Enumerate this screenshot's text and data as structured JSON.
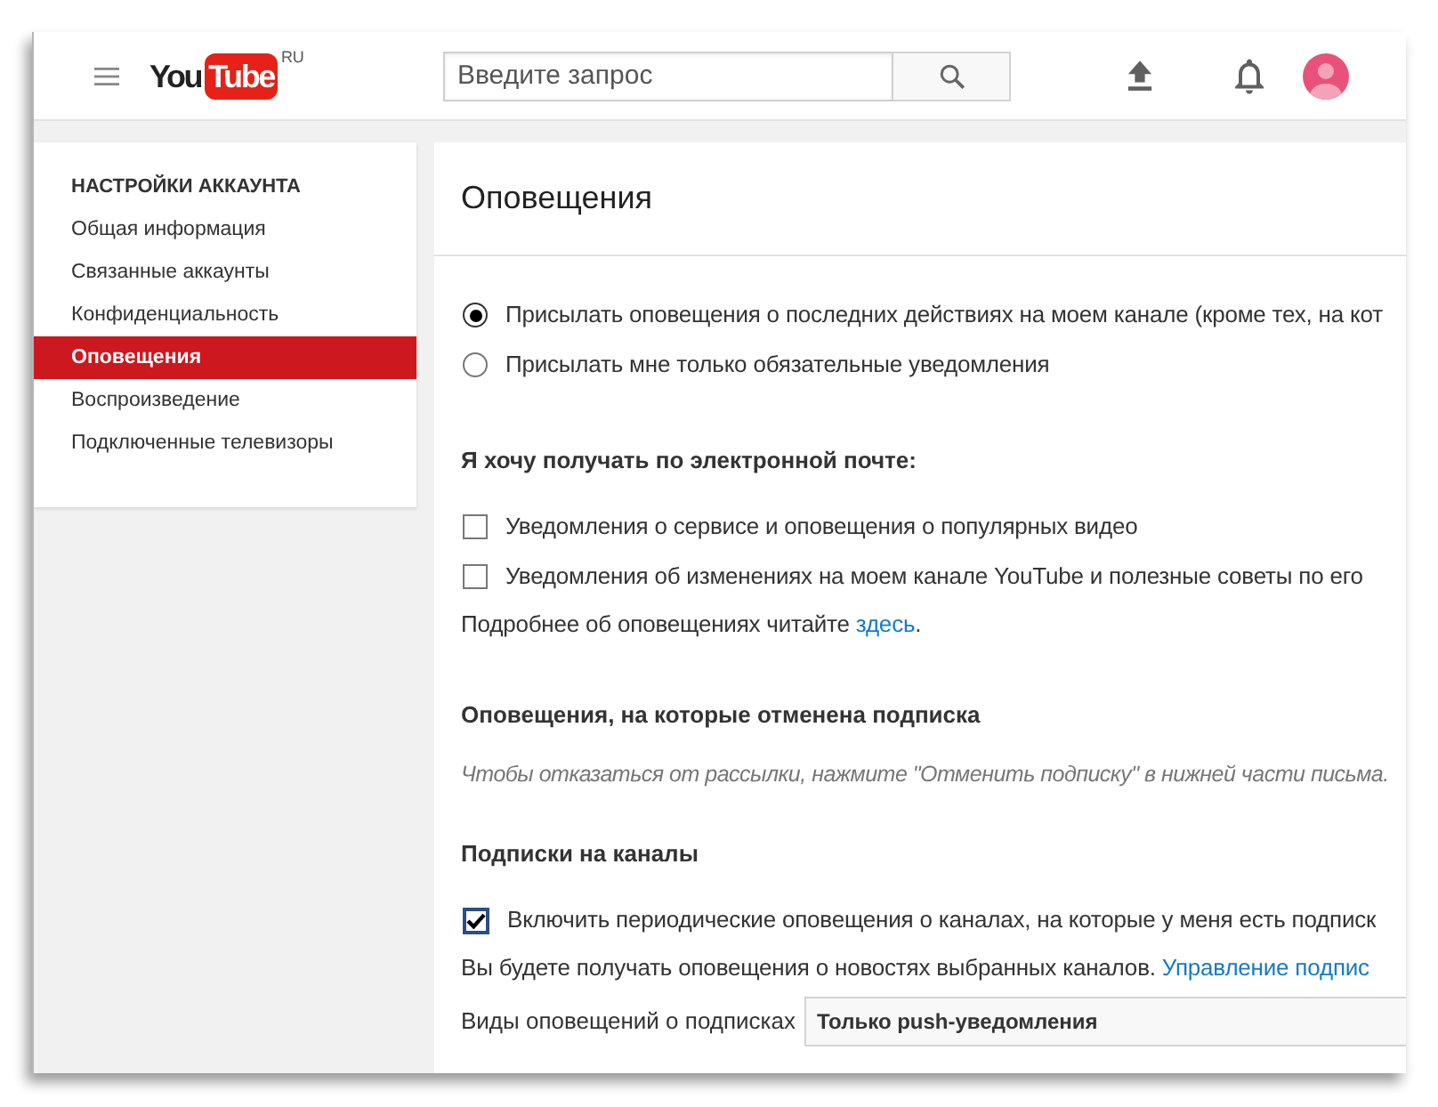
{
  "header": {
    "logo": {
      "word": "You",
      "tile": "Tube",
      "region": "RU"
    },
    "search": {
      "placeholder": "Введите запрос"
    }
  },
  "sidebar": {
    "heading": "НАСТРОЙКИ АККАУНТА",
    "items": [
      {
        "label": "Общая информация",
        "selected": false
      },
      {
        "label": "Связанные аккаунты",
        "selected": false
      },
      {
        "label": "Конфиденциальность",
        "selected": false
      },
      {
        "label": "Оповещения",
        "selected": true
      },
      {
        "label": "Воспроизведение",
        "selected": false
      },
      {
        "label": "Подключенные телевизоры",
        "selected": false
      }
    ]
  },
  "main": {
    "title": "Оповещения",
    "delivery_options": [
      {
        "label": "Присылать оповещения о последних действиях на моем канале (кроме тех, на кот",
        "selected": true
      },
      {
        "label": "Присылать мне только обязательные уведомления",
        "selected": false
      }
    ],
    "email": {
      "heading": "Я хочу получать по электронной почте:",
      "options": [
        {
          "label": "Уведомления о сервисе и оповещения о популярных видео",
          "checked": false
        },
        {
          "label": "Уведомления об изменениях на моем канале YouTube и полезные советы по его",
          "checked": false
        }
      ],
      "note": {
        "text": "Подробнее об оповещениях читайте",
        "link": "здесь",
        "after": "."
      }
    },
    "unsubscribed": {
      "heading": "Оповещения, на которые отменена подписка",
      "note": "Чтобы отказаться от рассылки, нажмите \"Отменить подписку\" в нижней части письма."
    },
    "subscriptions": {
      "heading": "Подписки на каналы",
      "options": [
        {
          "label": "Включить периодические оповещения о каналах, на которые у меня есть подписк",
          "checked": true
        }
      ],
      "note": {
        "text": "Вы будете получать оповещения о новостях выбранных каналов.",
        "link": "Управление подпис"
      },
      "type_field": {
        "label": "Виды оповещений о подписках",
        "value": "Только push-уведомления"
      }
    }
  }
}
